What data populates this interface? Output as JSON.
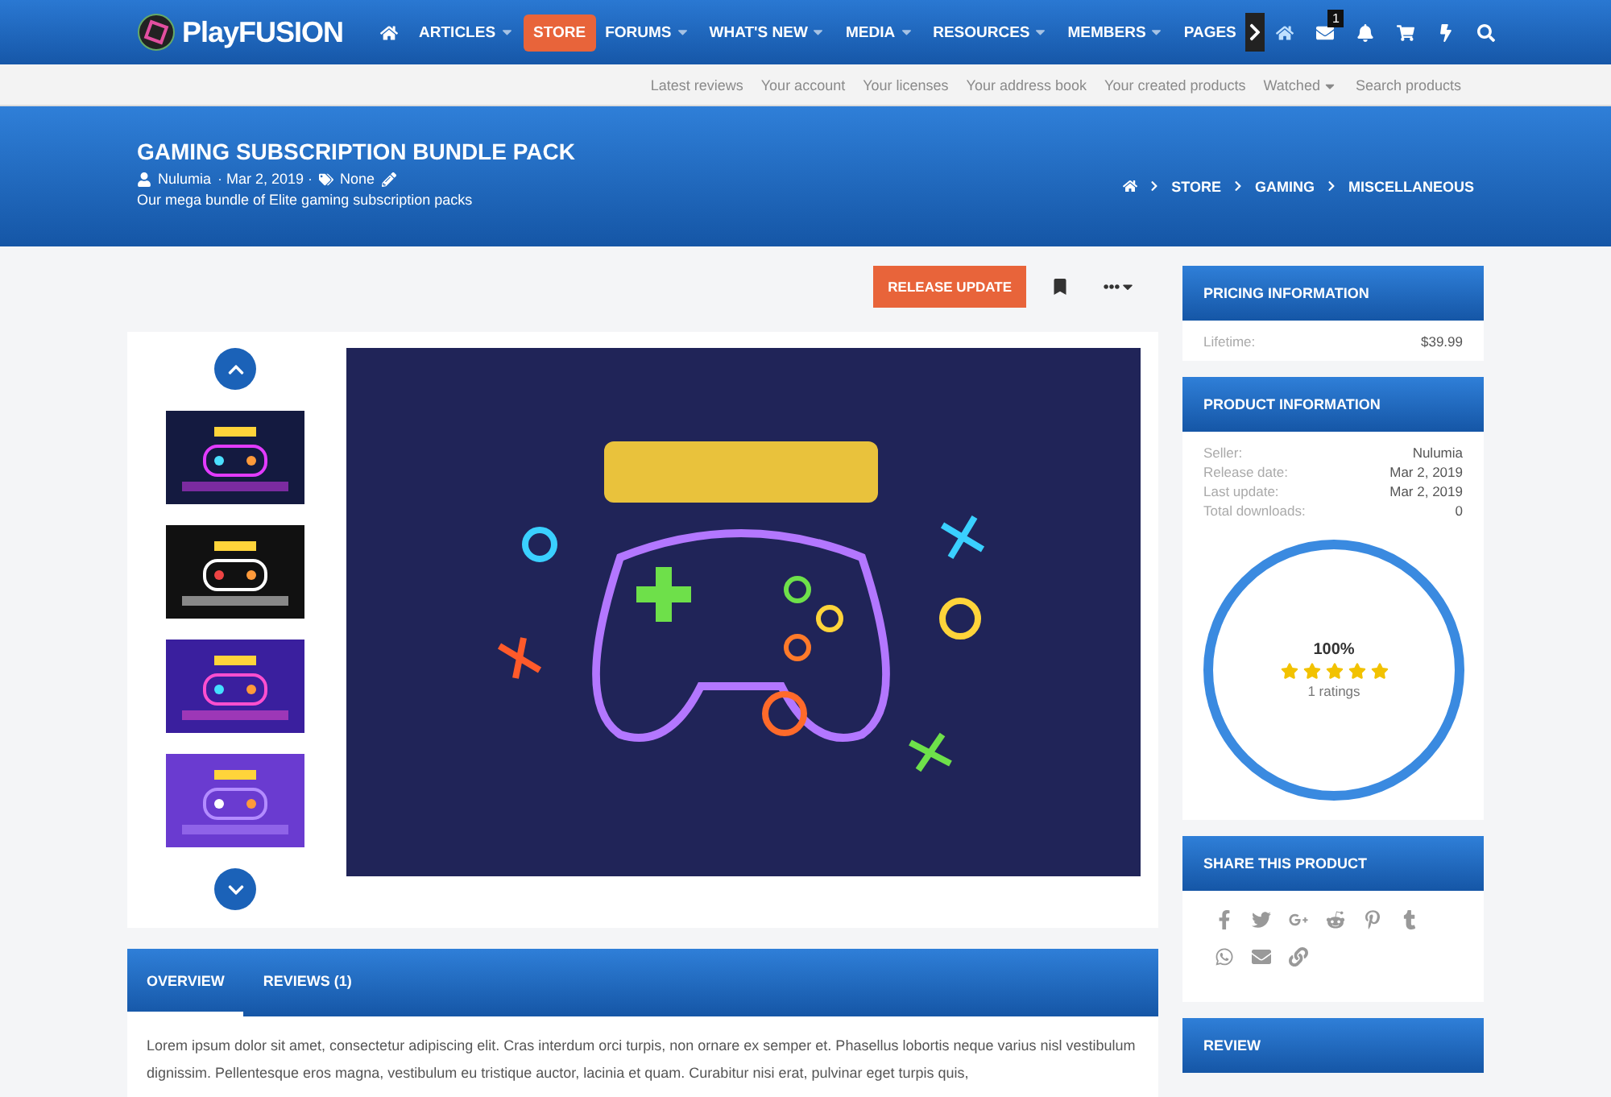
{
  "logo": {
    "text": "PlayFUSION"
  },
  "nav": [
    {
      "label": "ARTICLES",
      "dropdown": true,
      "selected": false
    },
    {
      "label": "STORE",
      "dropdown": false,
      "selected": true
    },
    {
      "label": "FORUMS",
      "dropdown": true,
      "selected": false
    },
    {
      "label": "WHAT'S NEW",
      "dropdown": true,
      "selected": false
    },
    {
      "label": "MEDIA",
      "dropdown": true,
      "selected": false
    },
    {
      "label": "RESOURCES",
      "dropdown": true,
      "selected": false
    },
    {
      "label": "MEMBERS",
      "dropdown": true,
      "selected": false
    },
    {
      "label": "PAGES",
      "dropdown": false,
      "selected": false
    }
  ],
  "inbox_badge": "1",
  "subnav": [
    {
      "label": "Latest reviews",
      "dropdown": false
    },
    {
      "label": "Your account",
      "dropdown": false
    },
    {
      "label": "Your licenses",
      "dropdown": false
    },
    {
      "label": "Your address book",
      "dropdown": false
    },
    {
      "label": "Your created products",
      "dropdown": false
    },
    {
      "label": "Watched",
      "dropdown": true
    },
    {
      "label": "Search products",
      "dropdown": false
    }
  ],
  "product": {
    "title": "GAMING SUBSCRIPTION BUNDLE PACK",
    "author": "Nulumia",
    "date": "· Mar 2, 2019 ·",
    "tags": "None",
    "tagline": "Our mega bundle of Elite gaming subscription packs"
  },
  "breadcrumbs": [
    "STORE",
    "GAMING",
    "MISCELLANEOUS"
  ],
  "release_button": "RELEASE UPDATE",
  "gallery": {
    "thumbnails": [
      {
        "kind": "picture"
      },
      {
        "kind": "picture"
      },
      {
        "kind": "picture"
      },
      {
        "kind": "picture"
      }
    ]
  },
  "tabs": [
    {
      "label": "OVERVIEW",
      "selected": true
    },
    {
      "label": "REVIEWS (1)",
      "selected": false
    }
  ],
  "overview": "Lorem ipsum dolor sit amet, consectetur adipiscing elit. Cras interdum orci turpis, non ornare ex semper et. Phasellus lobortis neque varius nisl vestibulum dignissim. Pellentesque eros magna, vestibulum eu tristique auctor, lacinia et quam. Curabitur nisi erat, pulvinar eget turpis quis,",
  "pricing": {
    "title": "PRICING INFORMATION",
    "rows": [
      {
        "label": "Lifetime:",
        "value": "$39.99"
      }
    ]
  },
  "product_info": {
    "title": "PRODUCT INFORMATION",
    "rows": [
      {
        "label": "Seller:",
        "value": "Nulumia"
      },
      {
        "label": "Release date:",
        "value": "Mar 2, 2019"
      },
      {
        "label": "Last update:",
        "value": "Mar 2, 2019"
      },
      {
        "label": "Total downloads:",
        "value": "0"
      }
    ],
    "rating": {
      "percent": "100%",
      "stars": 5,
      "count": "1 ratings"
    }
  },
  "share": {
    "title": "SHARE THIS PRODUCT"
  },
  "review": {
    "title": "REVIEW"
  }
}
